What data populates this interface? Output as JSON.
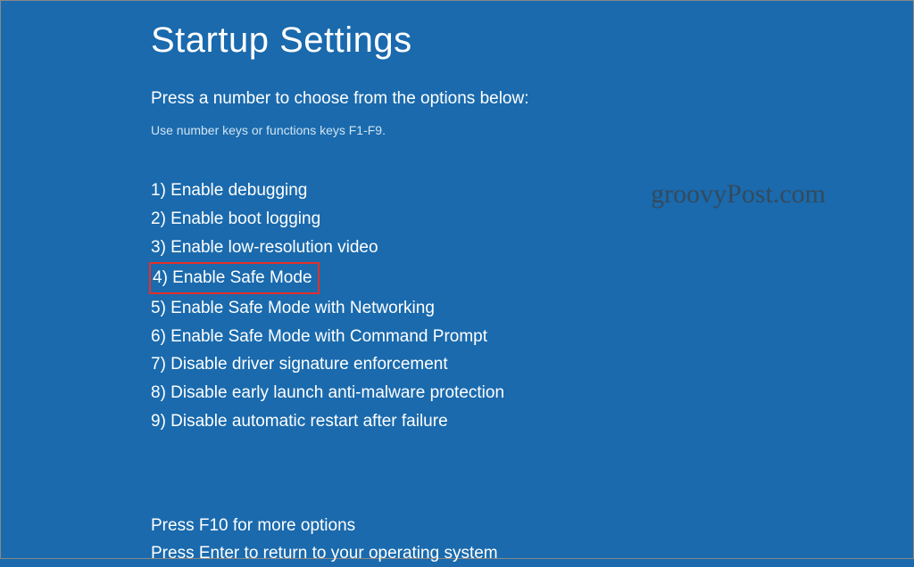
{
  "title": "Startup Settings",
  "subtitle": "Press a number to choose from the options below:",
  "hint": "Use number keys or functions keys F1-F9.",
  "options": [
    "1) Enable debugging",
    "2) Enable boot logging",
    "3) Enable low-resolution video",
    "4) Enable Safe Mode",
    "5) Enable Safe Mode with Networking",
    "6) Enable Safe Mode with Command Prompt",
    "7) Disable driver signature enforcement",
    "8) Disable early launch anti-malware protection",
    "9) Disable automatic restart after failure"
  ],
  "highlighted_index": 3,
  "footer": {
    "more_options": "Press F10 for more options",
    "return": "Press Enter to return to your operating system"
  },
  "watermark": "groovyPost.com",
  "colors": {
    "background": "#1a6aad",
    "text": "#ffffff",
    "highlight_border": "#e4302a"
  }
}
